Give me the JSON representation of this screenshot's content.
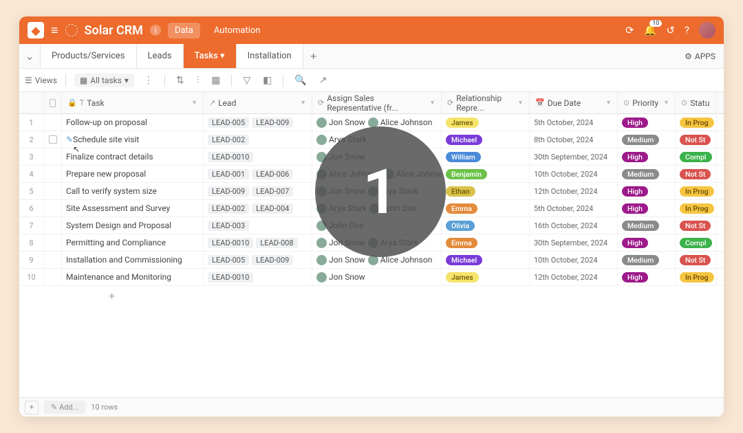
{
  "header": {
    "title": "Solar CRM",
    "data_tab": "Data",
    "automation_tab": "Automation",
    "badge": "10"
  },
  "tabs": [
    "Products/Services",
    "Leads",
    "Tasks",
    "Installation"
  ],
  "apps_label": "APPS",
  "toolbar": {
    "views": "Views",
    "all_tasks": "All tasks"
  },
  "columns": {
    "task": "Task",
    "lead": "Lead",
    "sales": "Assign Sales Representative (fr...",
    "rel": "Relationship Repre...",
    "due": "Due Date",
    "priority": "Priority",
    "status": "Statu"
  },
  "rows": [
    {
      "n": "1",
      "task": "Follow-up on proposal",
      "leads": [
        "LEAD-005",
        "LEAD-009"
      ],
      "sales": [
        "Jon Snow",
        "Alice Johnson"
      ],
      "rel": "James",
      "relc": "r-james",
      "due": "5th October, 2024",
      "pri": "High",
      "pric": "p-high",
      "stat": "In Prog",
      "statc": "s-inprog"
    },
    {
      "n": "2",
      "task": "Schedule site visit",
      "leads": [
        "LEAD-002"
      ],
      "sales": [
        "Arya Stark"
      ],
      "rel": "Michael",
      "relc": "r-michael",
      "due": "8th October, 2024",
      "pri": "Medium",
      "pric": "p-med",
      "stat": "Not St",
      "statc": "s-notst"
    },
    {
      "n": "3",
      "task": "Finalize contract details",
      "leads": [
        "LEAD-0010"
      ],
      "sales": [
        "Jon Snow"
      ],
      "rel": "William",
      "relc": "r-william",
      "due": "30th September, 2024",
      "pri": "High",
      "pric": "p-high",
      "stat": "Compl",
      "statc": "s-comp"
    },
    {
      "n": "4",
      "task": "Prepare new proposal",
      "leads": [
        "LEAD-001",
        "LEAD-006"
      ],
      "sales": [
        "Alice Johnson",
        "Alice Johnson"
      ],
      "rel": "Benjamin",
      "relc": "r-benjamin",
      "due": "10th October, 2024",
      "pri": "Medium",
      "pric": "p-med",
      "stat": "Not St",
      "statc": "s-notst"
    },
    {
      "n": "5",
      "task": "Call to verify system size",
      "leads": [
        "LEAD-009",
        "LEAD-007"
      ],
      "sales": [
        "Jon Snow",
        "Arya Stark"
      ],
      "rel": "Ethan",
      "relc": "r-ethan",
      "due": "12th October, 2024",
      "pri": "High",
      "pric": "p-high",
      "stat": "In Prog",
      "statc": "s-inprog"
    },
    {
      "n": "6",
      "task": "Site Assessment and Survey",
      "leads": [
        "LEAD-002",
        "LEAD-004"
      ],
      "sales": [
        "Arya Stark",
        "John Doe"
      ],
      "rel": "Emma",
      "relc": "r-emma",
      "due": "5th October, 2024",
      "pri": "High",
      "pric": "p-high",
      "stat": "In Prog",
      "statc": "s-inprog"
    },
    {
      "n": "7",
      "task": "System Design and Proposal",
      "leads": [
        "LEAD-003"
      ],
      "sales": [
        "John Doe"
      ],
      "rel": "Olivia",
      "relc": "r-olivia",
      "due": "16th October, 2024",
      "pri": "Medium",
      "pric": "p-med",
      "stat": "Not St",
      "statc": "s-notst"
    },
    {
      "n": "8",
      "task": "Permitting and Compliance",
      "leads": [
        "LEAD-0010",
        "LEAD-008"
      ],
      "sales": [
        "Jon Snow",
        "Arya Stark"
      ],
      "rel": "Emma",
      "relc": "r-emma",
      "due": "30th September, 2024",
      "pri": "High",
      "pric": "p-high",
      "stat": "Compl",
      "statc": "s-comp"
    },
    {
      "n": "9",
      "task": "Installation and Commissioning",
      "leads": [
        "LEAD-005",
        "LEAD-009"
      ],
      "sales": [
        "Jon Snow",
        "Alice Johnson"
      ],
      "rel": "Michael",
      "relc": "r-michael",
      "due": "10th October, 2024",
      "pri": "Medium",
      "pric": "p-med",
      "stat": "Not St",
      "statc": "s-notst"
    },
    {
      "n": "10",
      "task": "Maintenance and Monitoring",
      "leads": [
        "LEAD-0010"
      ],
      "sales": [
        "Jon Snow"
      ],
      "rel": "James",
      "relc": "r-james",
      "due": "12th October, 2024",
      "pri": "High",
      "pric": "p-high",
      "stat": "In Prog",
      "statc": "s-inprog"
    }
  ],
  "footer": {
    "add": "Add...",
    "rows": "10 rows"
  },
  "overlay": "1"
}
